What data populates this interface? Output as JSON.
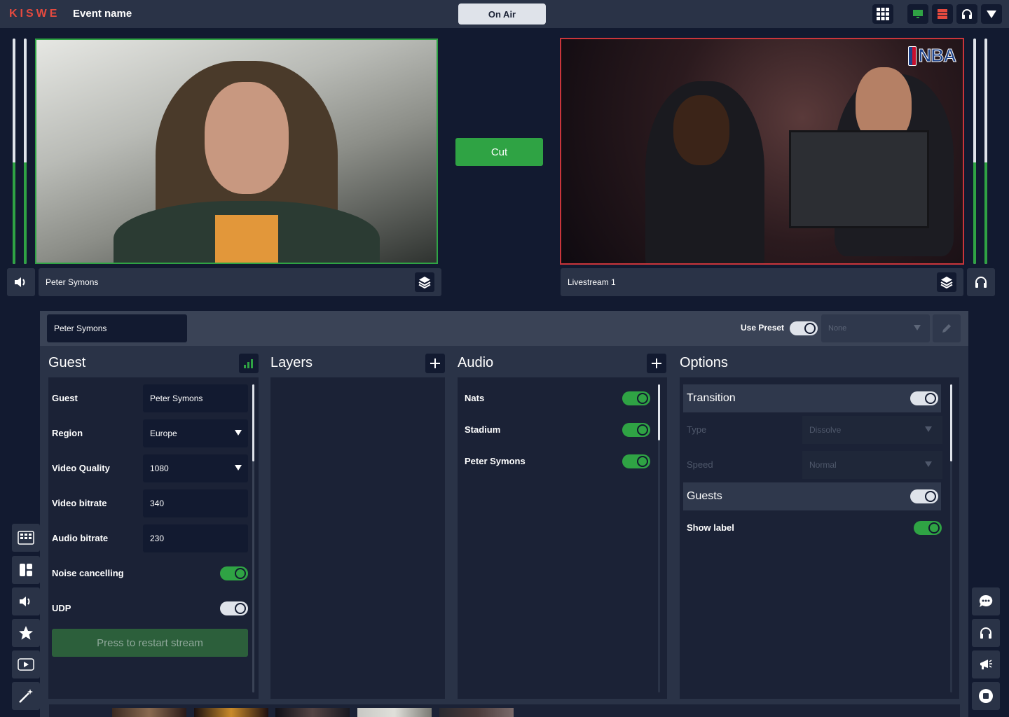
{
  "topbar": {
    "logo": "KISWE",
    "event_name": "Event name",
    "on_air_label": "On Air"
  },
  "sources": {
    "left": {
      "name": "Peter Symons",
      "audio_level": 0.45
    },
    "right": {
      "name": "Livestream 1",
      "audio_level": 0.45
    },
    "cut_label": "Cut",
    "right_logo": "NBA"
  },
  "panel": {
    "selected_source": "Peter Symons",
    "use_preset_label": "Use Preset",
    "preset_value": "None",
    "guest": {
      "title": "Guest",
      "rows": {
        "guest": {
          "label": "Guest",
          "value": "Peter Symons"
        },
        "region": {
          "label": "Region",
          "value": "Europe"
        },
        "video_quality": {
          "label": "Video Quality",
          "value": "1080"
        },
        "video_bitrate": {
          "label": "Video bitrate",
          "value": "340"
        },
        "audio_bitrate": {
          "label": "Audio bitrate",
          "value": "230"
        },
        "noise_cancelling": {
          "label": "Noise cancelling",
          "on": true
        },
        "udp": {
          "label": "UDP",
          "on": false
        }
      },
      "restart_label": "Press to restart stream"
    },
    "layers": {
      "title": "Layers"
    },
    "audio": {
      "title": "Audio",
      "items": [
        {
          "label": "Nats",
          "on": true
        },
        {
          "label": "Stadium",
          "on": true
        },
        {
          "label": "Peter Symons",
          "on": true
        }
      ]
    },
    "options": {
      "title": "Options",
      "transition": {
        "label": "Transition",
        "on": false
      },
      "type": {
        "label": "Type",
        "value": "Dissolve"
      },
      "speed": {
        "label": "Speed",
        "value": "Normal"
      },
      "guests": {
        "label": "Guests",
        "on": false
      },
      "show_label": {
        "label": "Show label",
        "on": true
      }
    }
  },
  "colors": {
    "accent_green": "#2fa344",
    "program_red": "#c9353b",
    "logo_red": "#e54a3f",
    "background": "#121a30",
    "panel": "#2a3347"
  }
}
